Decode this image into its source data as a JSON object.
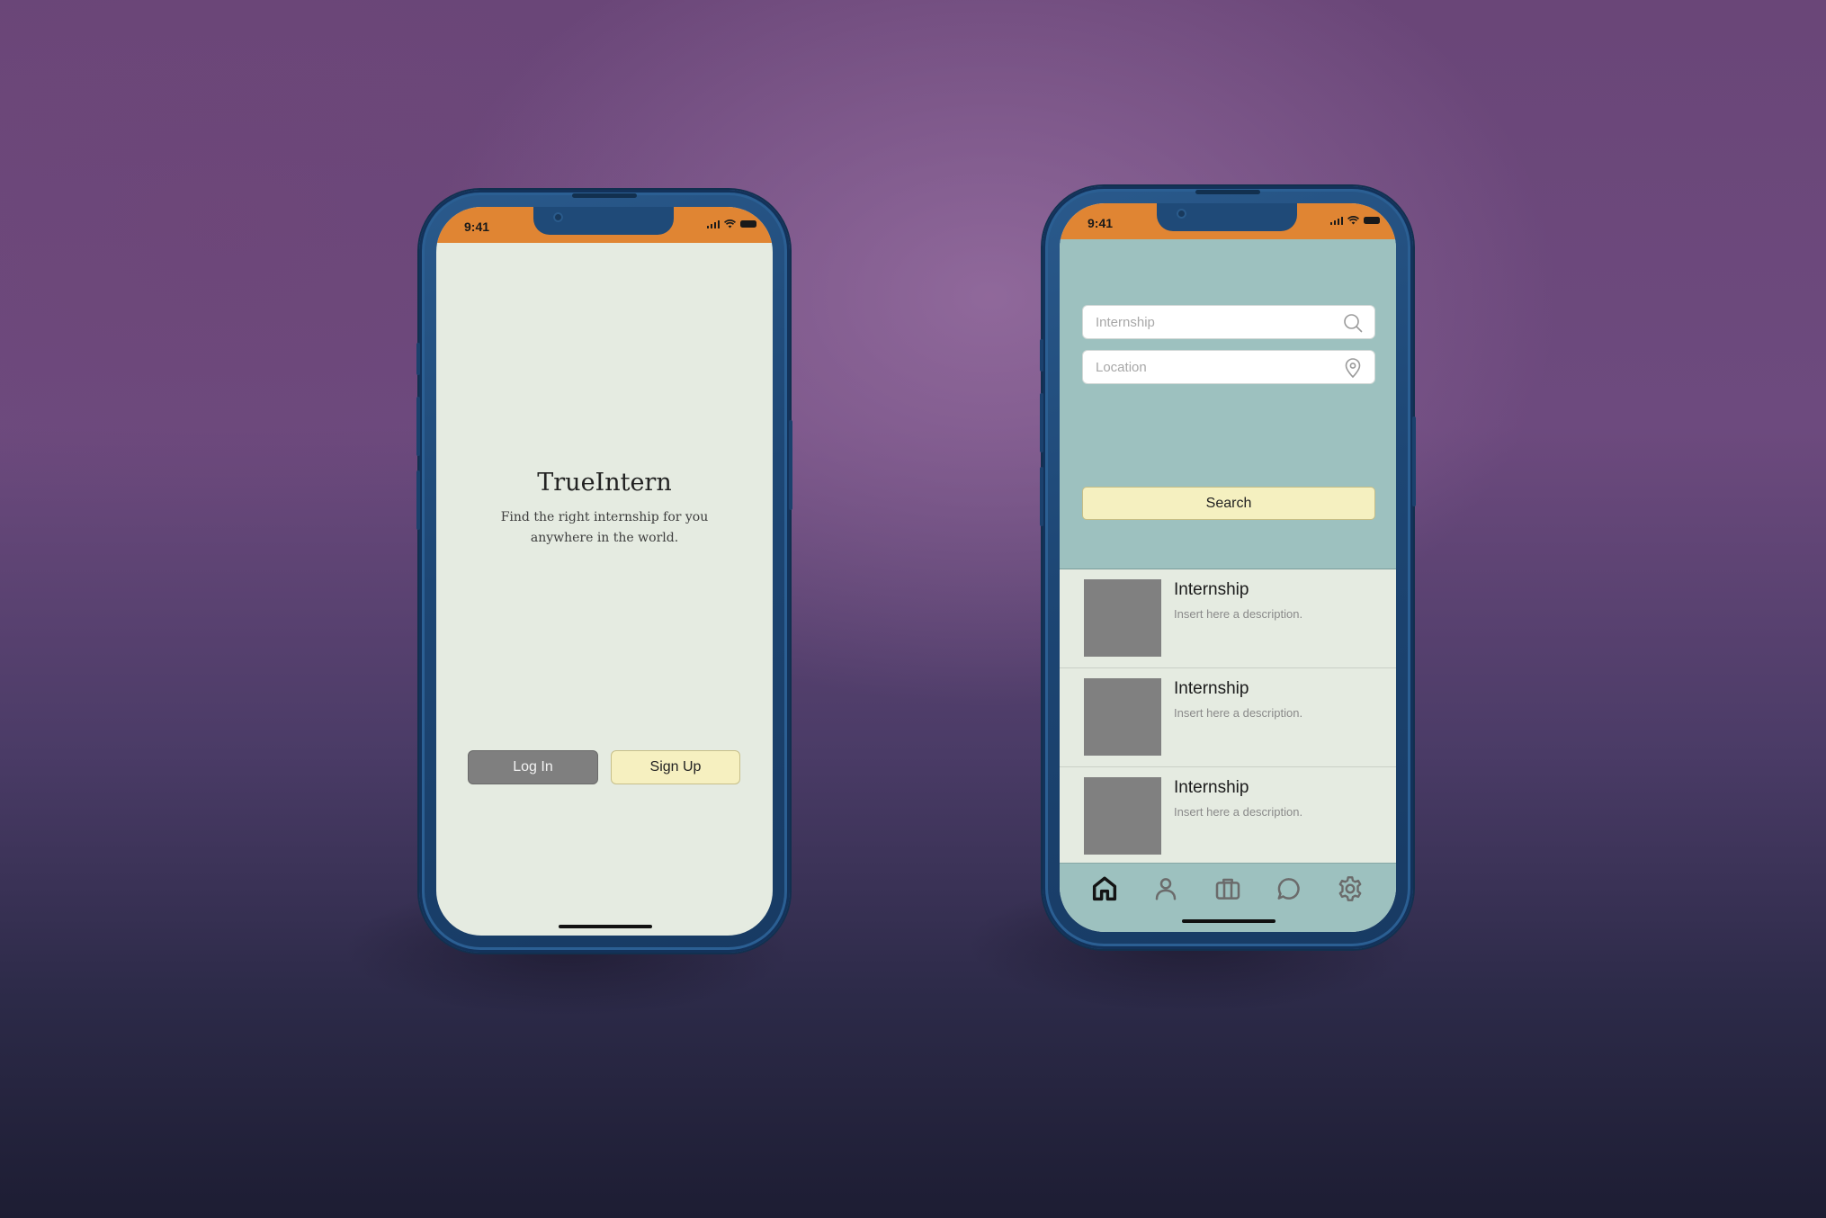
{
  "colors": {
    "statusbar": "#e08533",
    "phone_frame": "#1d4674",
    "screen_bg": "#e5ebe1",
    "teal_header": "#9dc1bf",
    "primary_button": "#f6f0c0",
    "secondary_button": "#7f7f7f",
    "thumbnail": "#808080"
  },
  "phone1": {
    "status": {
      "time": "9:41",
      "icons": [
        "signal-icon",
        "wifi-icon",
        "battery-icon"
      ]
    },
    "app_title": "TrueIntern",
    "tagline_line1": "Find the right internship for you",
    "tagline_line2": "anywhere in the world.",
    "login_label": "Log In",
    "signup_label": "Sign Up"
  },
  "phone2": {
    "status": {
      "time": "9:41",
      "icons": [
        "signal-icon",
        "wifi-icon",
        "battery-icon"
      ]
    },
    "search": {
      "internship_placeholder": "Internship",
      "internship_icon": "search-icon",
      "location_placeholder": "Location",
      "location_icon": "location-pin-icon",
      "button_label": "Search"
    },
    "results": [
      {
        "title": "Internship",
        "description": "Insert here a description."
      },
      {
        "title": "Internship",
        "description": "Insert here a description."
      },
      {
        "title": "Internship",
        "description": "Insert here a description."
      }
    ],
    "tabbar": [
      {
        "icon": "home-icon",
        "active": true
      },
      {
        "icon": "profile-icon",
        "active": false
      },
      {
        "icon": "briefcase-icon",
        "active": false
      },
      {
        "icon": "chat-icon",
        "active": false
      },
      {
        "icon": "settings-icon",
        "active": false
      }
    ]
  }
}
